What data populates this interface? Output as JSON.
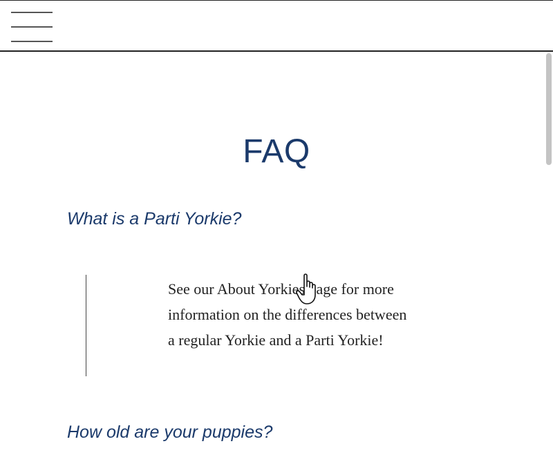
{
  "header": {
    "menu_icon": "hamburger-menu-icon"
  },
  "main": {
    "title": "FAQ",
    "faq": [
      {
        "question": "What is a Parti Yorkie?",
        "answer": "See our About Yorkies page for more information on the differences between a regular Yorkie and a Parti Yorkie!"
      },
      {
        "question": "How old are your puppies?"
      }
    ]
  },
  "colors": {
    "heading": "#1b3a6b",
    "body_text": "#222222",
    "divider": "#222222",
    "scrollbar_thumb": "#c4c4c4"
  },
  "overlay": {
    "cursor_icon": "hand-pointer-icon"
  }
}
